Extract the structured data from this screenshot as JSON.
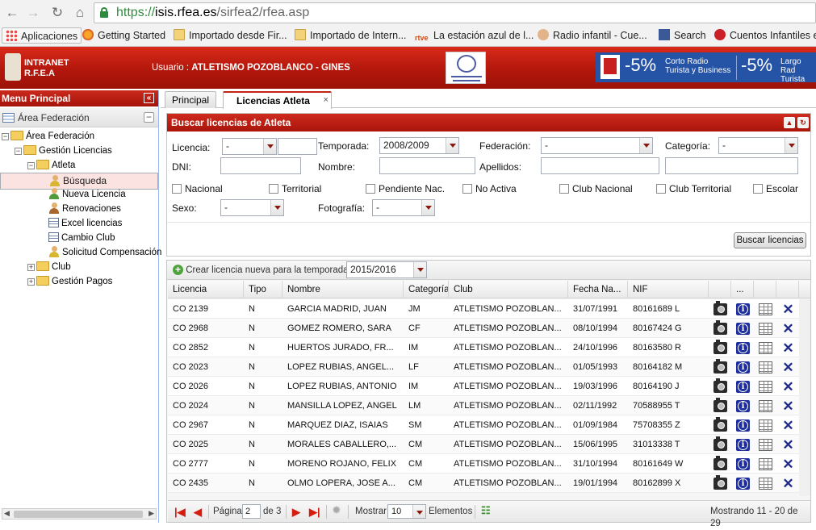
{
  "browser": {
    "url_scheme": "https://",
    "url_host": "isis.rfea.es",
    "url_path": "/sirfea2/rfea.asp",
    "bookmarks": [
      "Aplicaciones",
      "Getting Started",
      "Importado desde Fir...",
      "Importado de Intern...",
      "La estación azul de l...",
      "Radio infantil - Cue...",
      "Search",
      "Cuentos Infantiles e"
    ]
  },
  "header": {
    "logo_line1": "INTRANET",
    "logo_line2": "R.F.E.A",
    "user_label": "Usuario :",
    "user_name": "ATLETISMO POZOBLANCO - GINES",
    "banner_pct1": "-5%",
    "banner_txt1a": "Corto Radio",
    "banner_txt1b": "Turista y Business",
    "banner_pct2": "-5%",
    "banner_txt2a": "Largo Rad",
    "banner_txt2b": "Turista"
  },
  "sidebar": {
    "title": "Menu Principal",
    "section": "Área Federación",
    "tree": {
      "root": "Área Federación",
      "gestion_licencias": "Gestión Licencias",
      "atleta": "Atleta",
      "busqueda": "Búsqueda",
      "nueva_licencia": "Nueva Licencia",
      "renovaciones": "Renovaciones",
      "excel_licencias": "Excel licencias",
      "cambio_club": "Cambio Club",
      "solicitud_compensacion": "Solicitud Compensación",
      "club": "Club",
      "gestion_pagos": "Gestión Pagos"
    }
  },
  "tabs": {
    "principal": "Principal",
    "licencias": "Licencias Atleta"
  },
  "search": {
    "title": "Buscar licencias de Atleta",
    "licencia_label": "Licencia:",
    "licencia_value": "-",
    "temporada_label": "Temporada:",
    "temporada_value": "2008/2009",
    "federacion_label": "Federación:",
    "federacion_value": "-",
    "categoria_label": "Categoría:",
    "categoria_value": "-",
    "dni_label": "DNI:",
    "nombre_label": "Nombre:",
    "apellidos_label": "Apellidos:",
    "checks": [
      "Nacional",
      "Territorial",
      "Pendiente Nac.",
      "No Activa",
      "Club Nacional",
      "Club Territorial",
      "Escolar"
    ],
    "sexo_label": "Sexo:",
    "sexo_value": "-",
    "fotografia_label": "Fotografía:",
    "fotografia_value": "-",
    "button": "Buscar licencias"
  },
  "grid": {
    "create_label": "Crear licencia nueva para la temporada:",
    "create_season": "2015/2016",
    "columns": [
      "Licencia",
      "Tipo",
      "Nombre",
      "Categoría",
      "Club",
      "Fecha Na...",
      "NIF",
      "",
      "...",
      "",
      ""
    ],
    "rows": [
      {
        "licencia": "CO 2139",
        "tipo": "N",
        "nombre": "GARCIA MADRID, JUAN",
        "categoria": "JM",
        "club": "ATLETISMO POZOBLAN...",
        "fecha": "31/07/1991",
        "nif": "80161689 L"
      },
      {
        "licencia": "CO 2968",
        "tipo": "N",
        "nombre": "GOMEZ ROMERO, SARA",
        "categoria": "CF",
        "club": "ATLETISMO POZOBLAN...",
        "fecha": "08/10/1994",
        "nif": "80167424 G"
      },
      {
        "licencia": "CO 2852",
        "tipo": "N",
        "nombre": "HUERTOS JURADO, FR...",
        "categoria": "IM",
        "club": "ATLETISMO POZOBLAN...",
        "fecha": "24/10/1996",
        "nif": "80163580 R"
      },
      {
        "licencia": "CO 2023",
        "tipo": "N",
        "nombre": "LOPEZ RUBIAS, ANGEL...",
        "categoria": "LF",
        "club": "ATLETISMO POZOBLAN...",
        "fecha": "01/05/1993",
        "nif": "80164182 M"
      },
      {
        "licencia": "CO 2026",
        "tipo": "N",
        "nombre": "LOPEZ RUBIAS, ANTONIO",
        "categoria": "IM",
        "club": "ATLETISMO POZOBLAN...",
        "fecha": "19/03/1996",
        "nif": "80164190 J"
      },
      {
        "licencia": "CO 2024",
        "tipo": "N",
        "nombre": "MANSILLA LOPEZ, ANGEL",
        "categoria": "LM",
        "club": "ATLETISMO POZOBLAN...",
        "fecha": "02/11/1992",
        "nif": "70588955 T"
      },
      {
        "licencia": "CO 2967",
        "tipo": "N",
        "nombre": "MARQUEZ DIAZ, ISAIAS",
        "categoria": "SM",
        "club": "ATLETISMO POZOBLAN...",
        "fecha": "01/09/1984",
        "nif": "75708355 Z"
      },
      {
        "licencia": "CO 2025",
        "tipo": "N",
        "nombre": "MORALES CABALLERO,...",
        "categoria": "CM",
        "club": "ATLETISMO POZOBLAN...",
        "fecha": "15/06/1995",
        "nif": "31013338 T"
      },
      {
        "licencia": "CO 2777",
        "tipo": "N",
        "nombre": "MORENO ROJANO, FELIX",
        "categoria": "CM",
        "club": "ATLETISMO POZOBLAN...",
        "fecha": "31/10/1994",
        "nif": "80161649 W"
      },
      {
        "licencia": "CO 2435",
        "tipo": "N",
        "nombre": "OLMO LOPERA, JOSE A...",
        "categoria": "CM",
        "club": "ATLETISMO POZOBLAN...",
        "fecha": "19/01/1994",
        "nif": "80162899 X"
      }
    ]
  },
  "pager": {
    "page_label": "Página",
    "page_value": "2",
    "of_label": "de 3",
    "show_label": "Mostrar",
    "show_value": "10",
    "items_label": "Elementos",
    "summary": "Mostrando 11 - 20 de 29"
  }
}
